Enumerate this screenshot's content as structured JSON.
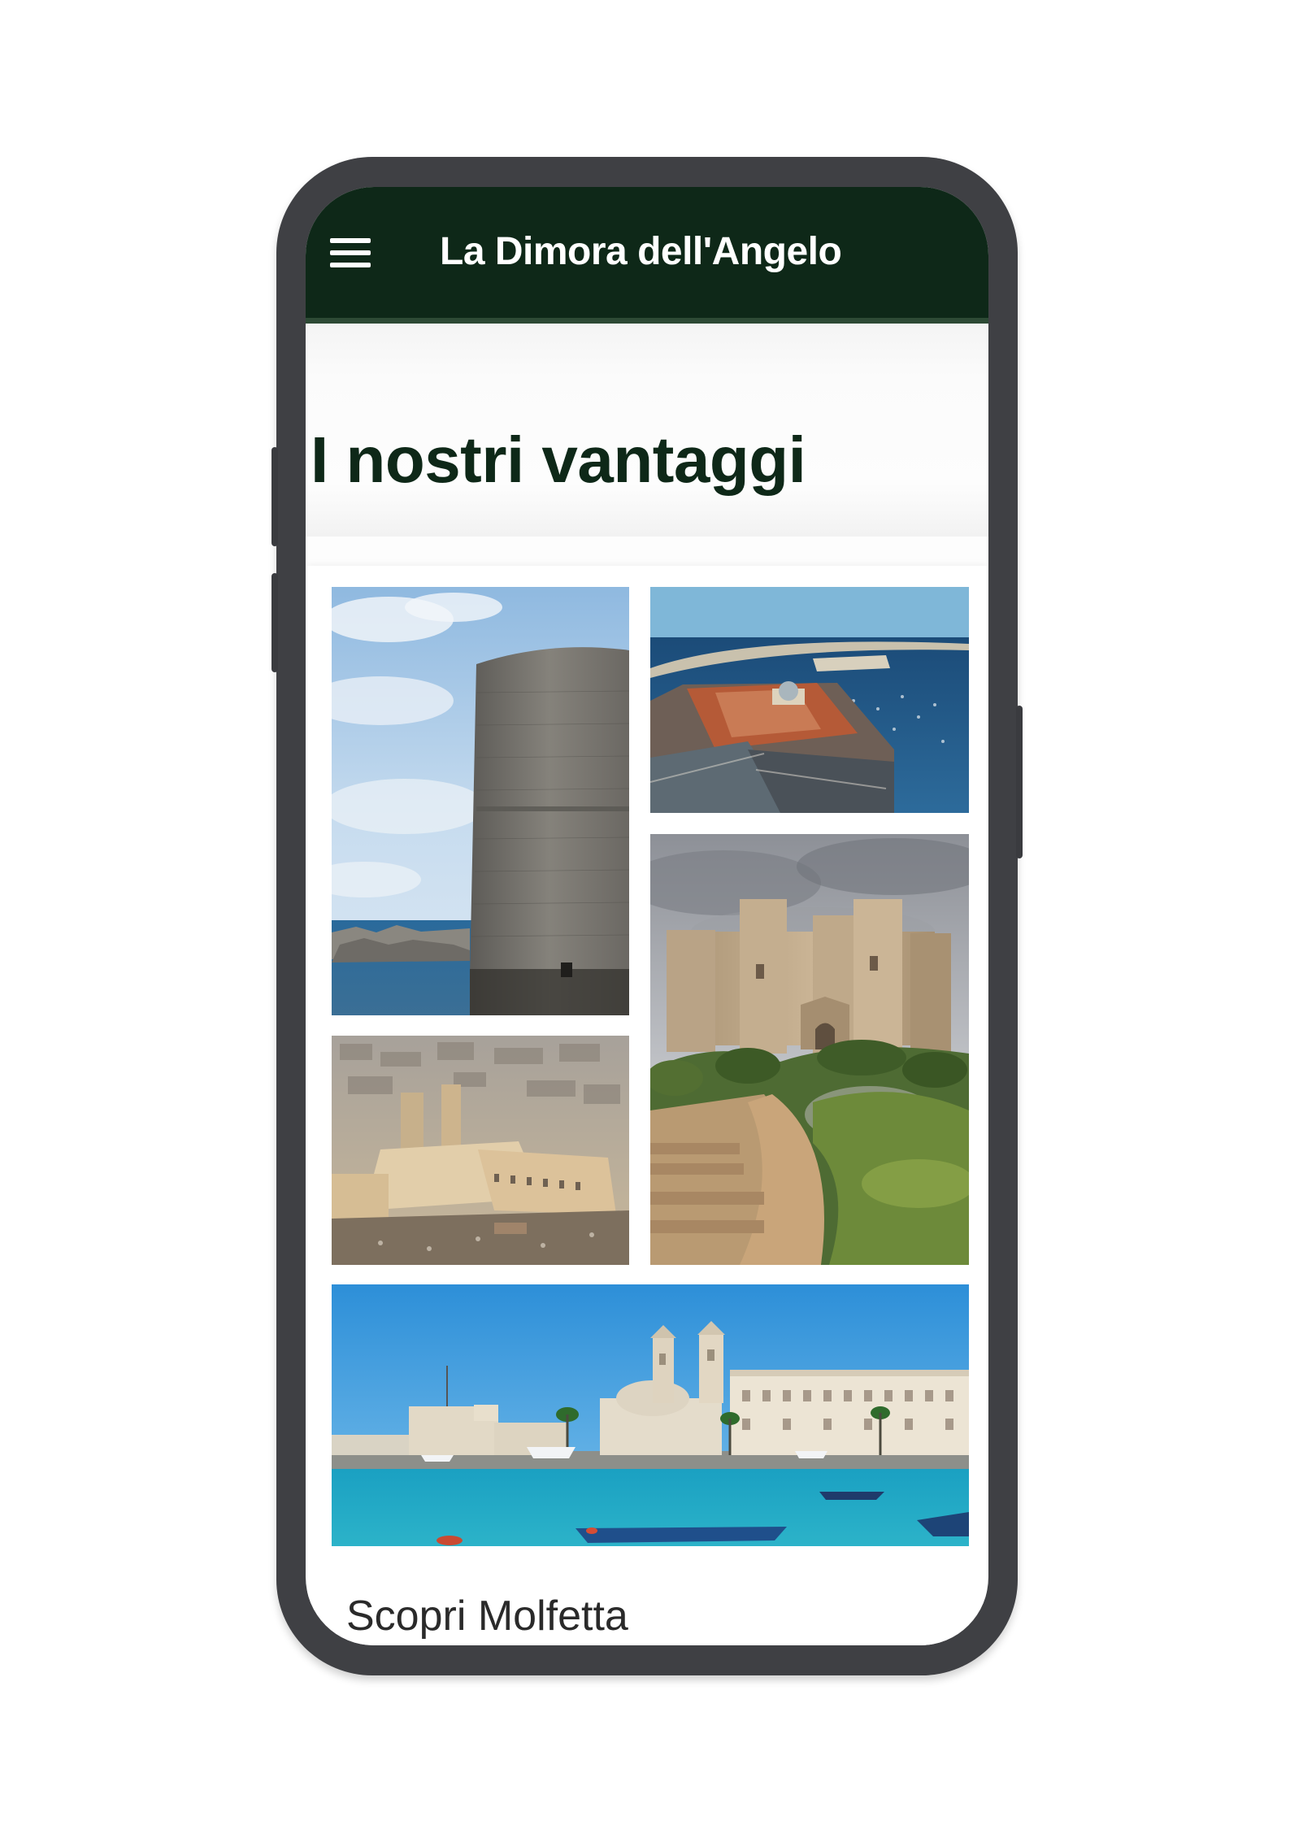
{
  "app_bar": {
    "title": "La Dimora dell'Angelo",
    "menu_icon": "hamburger-menu-icon",
    "background_color": "#0e2818"
  },
  "page": {
    "heading": "I nostri vantaggi"
  },
  "gallery": {
    "photos": [
      {
        "subject": "stone round tower by the sea"
      },
      {
        "subject": "aerial view of harbour town with historic palace"
      },
      {
        "subject": "octagonal castle on a hill with stone steps"
      },
      {
        "subject": "aerial view of old town with cathedral towers"
      },
      {
        "subject": "harbour with cathedral twin towers and boats"
      }
    ]
  },
  "section": {
    "heading": "Scopri Molfetta"
  },
  "colors": {
    "phone_frame": "#3f4044",
    "heading_text": "#0e2818"
  }
}
